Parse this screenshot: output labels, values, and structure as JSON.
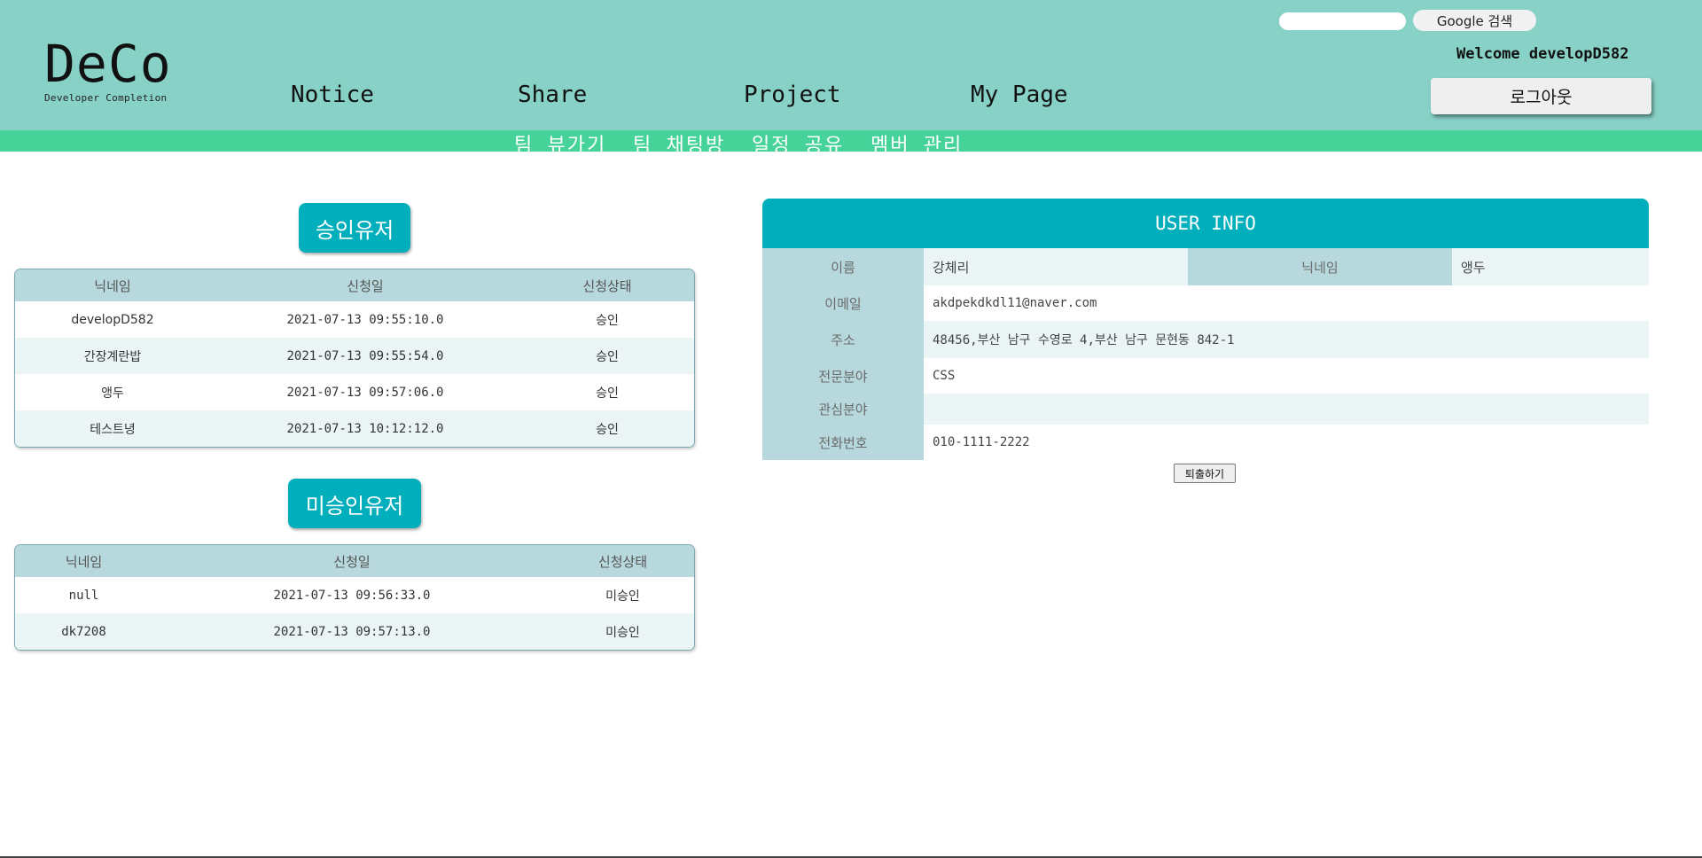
{
  "logo": {
    "title": "DeCo",
    "subtitle": "Developer Completion"
  },
  "nav": [
    "Notice",
    "Share",
    "Project",
    "My Page"
  ],
  "search": {
    "value": "",
    "button_label": "Google 검색"
  },
  "welcome": "Welcome developD582",
  "logout_label": "로그아웃",
  "subnav": [
    "팀 뷰가기",
    "팀 채팅방",
    "일정 공유",
    "멤버 관리"
  ],
  "approved": {
    "title": "승인유저",
    "headers": [
      "닉네임",
      "신청일",
      "신청상태"
    ],
    "rows": [
      [
        "developD582",
        "2021-07-13 09:55:10.0",
        "승인"
      ],
      [
        "간장계란밥",
        "2021-07-13 09:55:54.0",
        "승인"
      ],
      [
        "앵두",
        "2021-07-13 09:57:06.0",
        "승인"
      ],
      [
        "테스트녕",
        "2021-07-13 10:12:12.0",
        "승인"
      ]
    ]
  },
  "pending": {
    "title": "미승인유저",
    "headers": [
      "닉네임",
      "신청일",
      "신청상태"
    ],
    "rows": [
      [
        "null",
        "2021-07-13 09:56:33.0",
        "미승인"
      ],
      [
        "dk7208",
        "2021-07-13 09:57:13.0",
        "미승인"
      ]
    ]
  },
  "user_info": {
    "title": "USER INFO",
    "name_label": "이름",
    "name": "강체리",
    "nickname_label": "닉네임",
    "nickname": "앵두",
    "email_label": "이메일",
    "email": "akdpekdkdl11@naver.com",
    "address_label": "주소",
    "address": "48456,부산 남구 수영로 4,부산 남구 문현동 842-1",
    "expertise_label": "전문분야",
    "expertise": "CSS",
    "interest_label": "관심분야",
    "interest": "",
    "phone_label": "전화번호",
    "phone": "010-1111-2222"
  },
  "withdraw_label": "퇴출하기"
}
